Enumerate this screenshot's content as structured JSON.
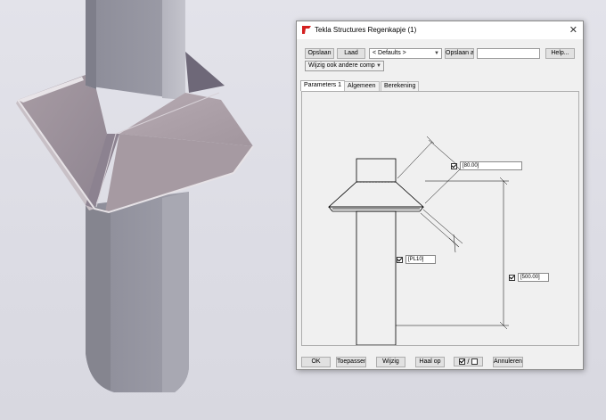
{
  "window": {
    "title": "Tekla Structures  Regenkapje (1)",
    "close_glyph": "✕",
    "icon": "tekla-logo-icon"
  },
  "toolbar": {
    "save_label": "Opslaan",
    "load_label": "Laad",
    "preset_value": "< Defaults >",
    "save_as_label": "Opslaan al",
    "save_as_value": "",
    "help_label": "Help...",
    "modify_mode_value": "Wijzig ook andere comp"
  },
  "tabs": [
    {
      "label": "Parameters 1",
      "active": true
    },
    {
      "label": "Algemeen",
      "active": false
    },
    {
      "label": "Berekening",
      "active": false
    }
  ],
  "params": {
    "slope_length": "[80.00]",
    "plate": "[PL10]",
    "height": "[500.00]"
  },
  "footer": {
    "ok_label": "OK",
    "apply_label": "Toepassen",
    "modify_label": "Wijzig",
    "get_label": "Haal op",
    "toggle_slash": "/",
    "cancel_label": "Annuleren"
  },
  "colors": {
    "column": "#9898a4",
    "skirt": "#a89ca4",
    "logo_red": "#d42020"
  }
}
